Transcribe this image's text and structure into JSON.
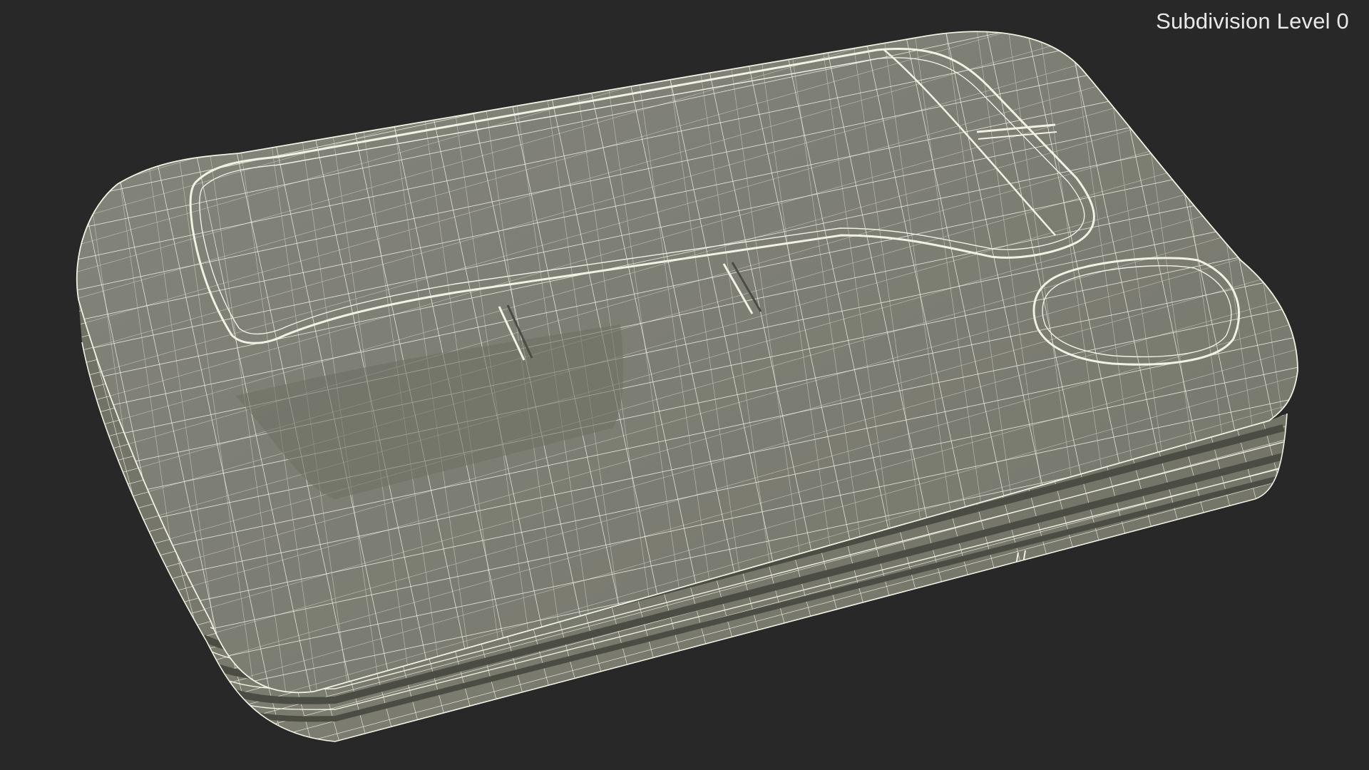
{
  "viewport": {
    "overlay_label": "Subdivision Level 0",
    "background_color": "#282828",
    "surface_color": "#7b7c6e",
    "wire_color": "#f1f1e4",
    "groove_color": "#4b4c44"
  }
}
